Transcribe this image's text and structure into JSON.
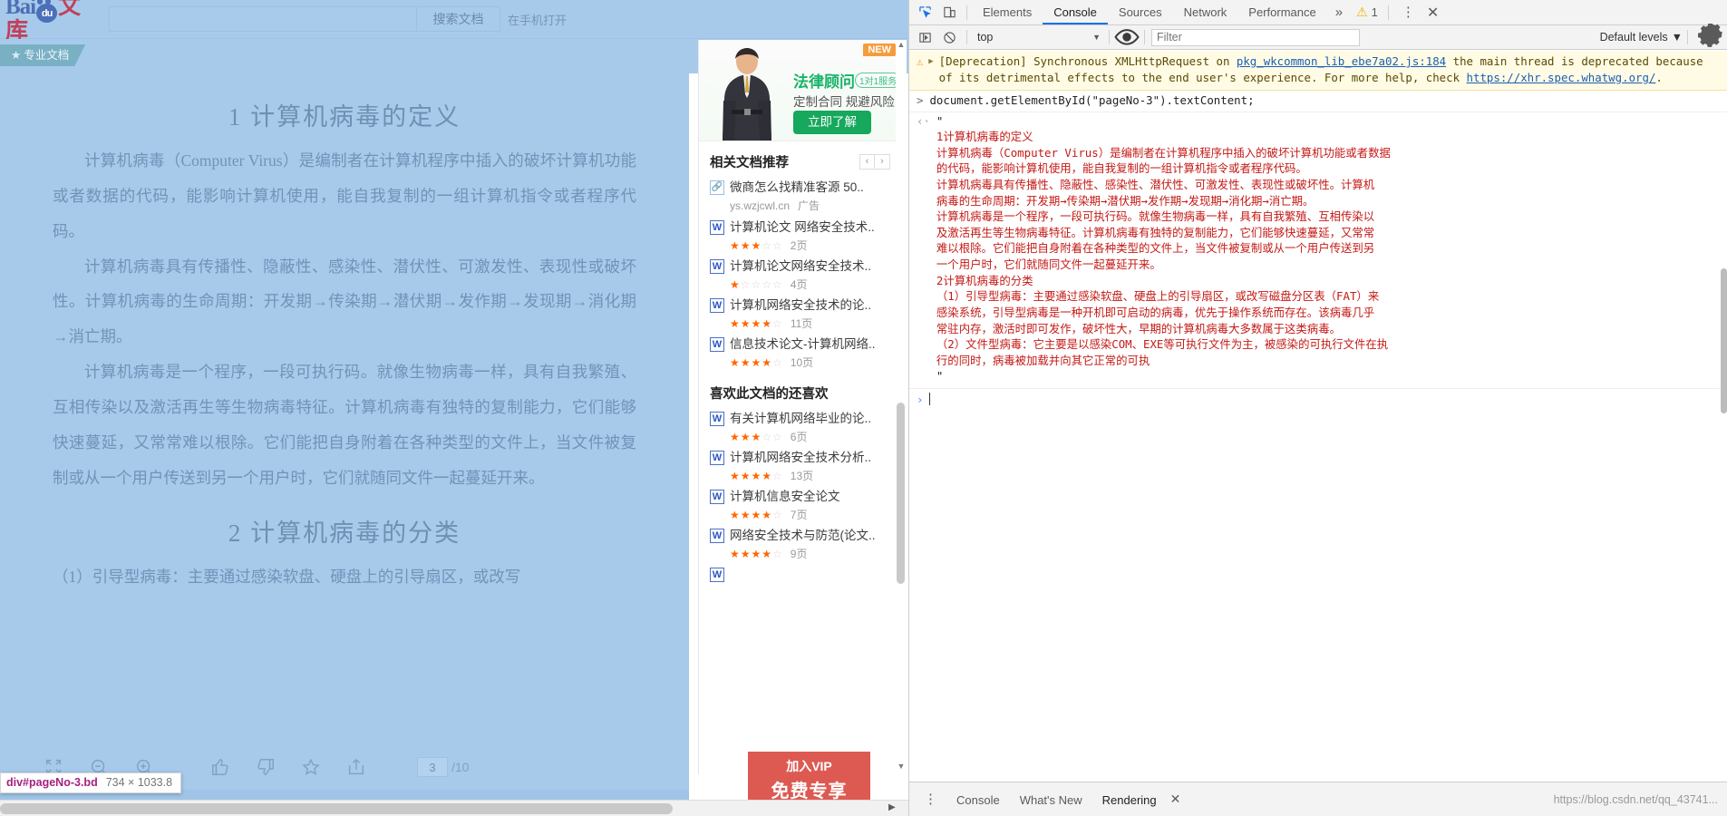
{
  "page": {
    "header": {
      "logo_text_prefix": "Bai",
      "logo_paw": "du",
      "logo_text_suffix": "文库",
      "search_value": "",
      "search_placeholder": "",
      "search_button": "搜索文档",
      "open_in_app": "在手机打开"
    },
    "subbar": {
      "pro_tag": "专业文档",
      "star_icon": "★"
    },
    "document": {
      "heading1": "1 计算机病毒的定义",
      "paragraphs": [
        "计算机病毒（Computer Virus）是编制者在计算机程序中插入的破坏计算机功能或者数据的代码，能影响计算机使用，能自我复制的一组计算机指令或者程序代码。",
        "计算机病毒具有传播性、隐蔽性、感染性、潜伏性、可激发性、表现性或破坏性。计算机病毒的生命周期：开发期→传染期→潜伏期→发作期→发现期→消化期→消亡期。",
        "计算机病毒是一个程序，一段可执行码。就像生物病毒一样，具有自我繁殖、互相传染以及激活再生等生物病毒特征。计算机病毒有独特的复制能力，它们能够快速蔓延，又常常难以根除。它们能把自身附着在各种类型的文件上，当文件被复制或从一个用户传送到另一个用户时，它们就随同文件一起蔓延开来。"
      ],
      "heading2": "2 计算机病毒的分类",
      "paragraph_after_h2": "（1）引导型病毒：主要通过感染软盘、硬盘上的引导扇区，或改写"
    },
    "toolbar": {
      "icons": [
        "fullscreen-icon",
        "zoom-out-icon",
        "zoom-in-icon",
        "thumbs-up-icon",
        "thumbs-down-icon",
        "favorite-star-icon",
        "share-icon"
      ],
      "page_current": "3",
      "page_total": "/10"
    },
    "inspect_tooltip": {
      "selector": "div#pageNo-3.bd",
      "dimensions": "734 × 1033.8"
    },
    "ad": {
      "badge": "NEW",
      "title": "法律顾问",
      "title_badge": "1对1服务",
      "subtitle": "定制合同 规避风险",
      "button": "立即了解"
    },
    "related": {
      "title": "相关文档推荐",
      "prev": "‹",
      "next": "›",
      "items": [
        {
          "icon": "link-icon",
          "title": "微商怎么找精准客源 50..",
          "url": "ys.wzjcwl.cn",
          "ad_label": "广告",
          "is_ad": true
        },
        {
          "icon": "word-icon",
          "title": "计算机论文 网络安全技术..",
          "stars": 2.5,
          "pages": "2页"
        },
        {
          "icon": "word-icon",
          "title": "计算机论文网络安全技术..",
          "stars": 1,
          "pages": "4页"
        },
        {
          "icon": "word-icon",
          "title": "计算机网络安全技术的论..",
          "stars": 3.5,
          "pages": "11页"
        },
        {
          "icon": "word-icon",
          "title": "信息技术论文-计算机网络..",
          "stars": 3.5,
          "pages": "10页"
        }
      ]
    },
    "also_like": {
      "title": "喜欢此文档的还喜欢",
      "items": [
        {
          "icon": "word-icon",
          "title": "有关计算机网络毕业的论..",
          "stars": 3,
          "pages": "6页"
        },
        {
          "icon": "word-icon",
          "title": "计算机网络安全技术分析..",
          "stars": 4,
          "pages": "13页"
        },
        {
          "icon": "word-icon",
          "title": "计算机信息安全论文",
          "stars": 4,
          "pages": "7页"
        },
        {
          "icon": "word-icon",
          "title": "网络安全技术与防范(论文..",
          "stars": 4,
          "pages": "9页"
        }
      ]
    },
    "vip_banner": {
      "line1": "加入VIP",
      "line2": "免费专享"
    }
  },
  "devtools": {
    "tabs": [
      {
        "label": "Elements",
        "active": false
      },
      {
        "label": "Console",
        "active": true
      },
      {
        "label": "Sources",
        "active": false
      },
      {
        "label": "Network",
        "active": false
      },
      {
        "label": "Performance",
        "active": false
      }
    ],
    "more_tabs": "»",
    "warning_count": "1",
    "kebab": "⋮",
    "close": "✕",
    "toolbar": {
      "context": "top",
      "caret": "▼",
      "filter_placeholder": "Filter",
      "filter_value": "",
      "levels": "Default levels",
      "levels_caret": "▼"
    },
    "messages": {
      "warning": {
        "prefix": "[Deprecation] Synchronous XMLHttpRequest on ",
        "link1": "pkg_wkcommon_lib_ebe7a02.js:184",
        "body": " the main thread is deprecated because of its detrimental effects to the end user's experience. For more help, check ",
        "link2": "https://xhr.spec.whatwg.org/",
        "suffix": "."
      },
      "input": "document.getElementById(\"pageNo-3\").textContent;",
      "output_open_quote": "\"",
      "output_lines": [
        "1计算机病毒的定义",
        "计算机病毒（Computer Virus）是编制者在计算机程序中插入的破坏计算机功能或者数据",
        "的代码，能影响计算机使用，能自我复制的一组计算机指令或者程序代码。",
        "计算机病毒具有传播性、隐蔽性、感染性、潜伏性、可激发性、表现性或破坏性。计算机",
        "病毒的生命周期：开发期→传染期→潜伏期→发作期→发现期→消化期→消亡期。",
        "计算机病毒是一个程序，一段可执行码。就像生物病毒一样，具有自我繁殖、互相传染以",
        "及激活再生等生物病毒特征。计算机病毒有独特的复制能力，它们能够快速蔓延，又常常",
        "难以根除。它们能把自身附着在各种类型的文件上，当文件被复制或从一个用户传送到另",
        "一个用户时，它们就随同文件一起蔓延开来。",
        "2计算机病毒的分类",
        "（1）引导型病毒：主要通过感染软盘、硬盘上的引导扇区，或改写磁盘分区表（FAT）来",
        "感染系统，引导型病毒是一种开机即可启动的病毒，优先于操作系统而存在。该病毒几乎",
        "常驻内存，激活时即可发作，破坏性大，早期的计算机病毒大多数属于这类病毒。",
        "（2）文件型病毒：它主要是以感染COM、EXE等可执行文件为主，被感染的可执行文件在执",
        "行的同时，病毒被加载并向其它正常的可执"
      ],
      "output_close_quote": "\"",
      "prompt_chevron": "›"
    },
    "drawer": {
      "kebab": "⋮",
      "tabs": [
        {
          "label": "Console",
          "active": false
        },
        {
          "label": "What's New",
          "active": false
        },
        {
          "label": "Rendering",
          "active": true
        }
      ],
      "close": "✕",
      "status_url": "https://blog.csdn.net/qq_43741..."
    }
  }
}
